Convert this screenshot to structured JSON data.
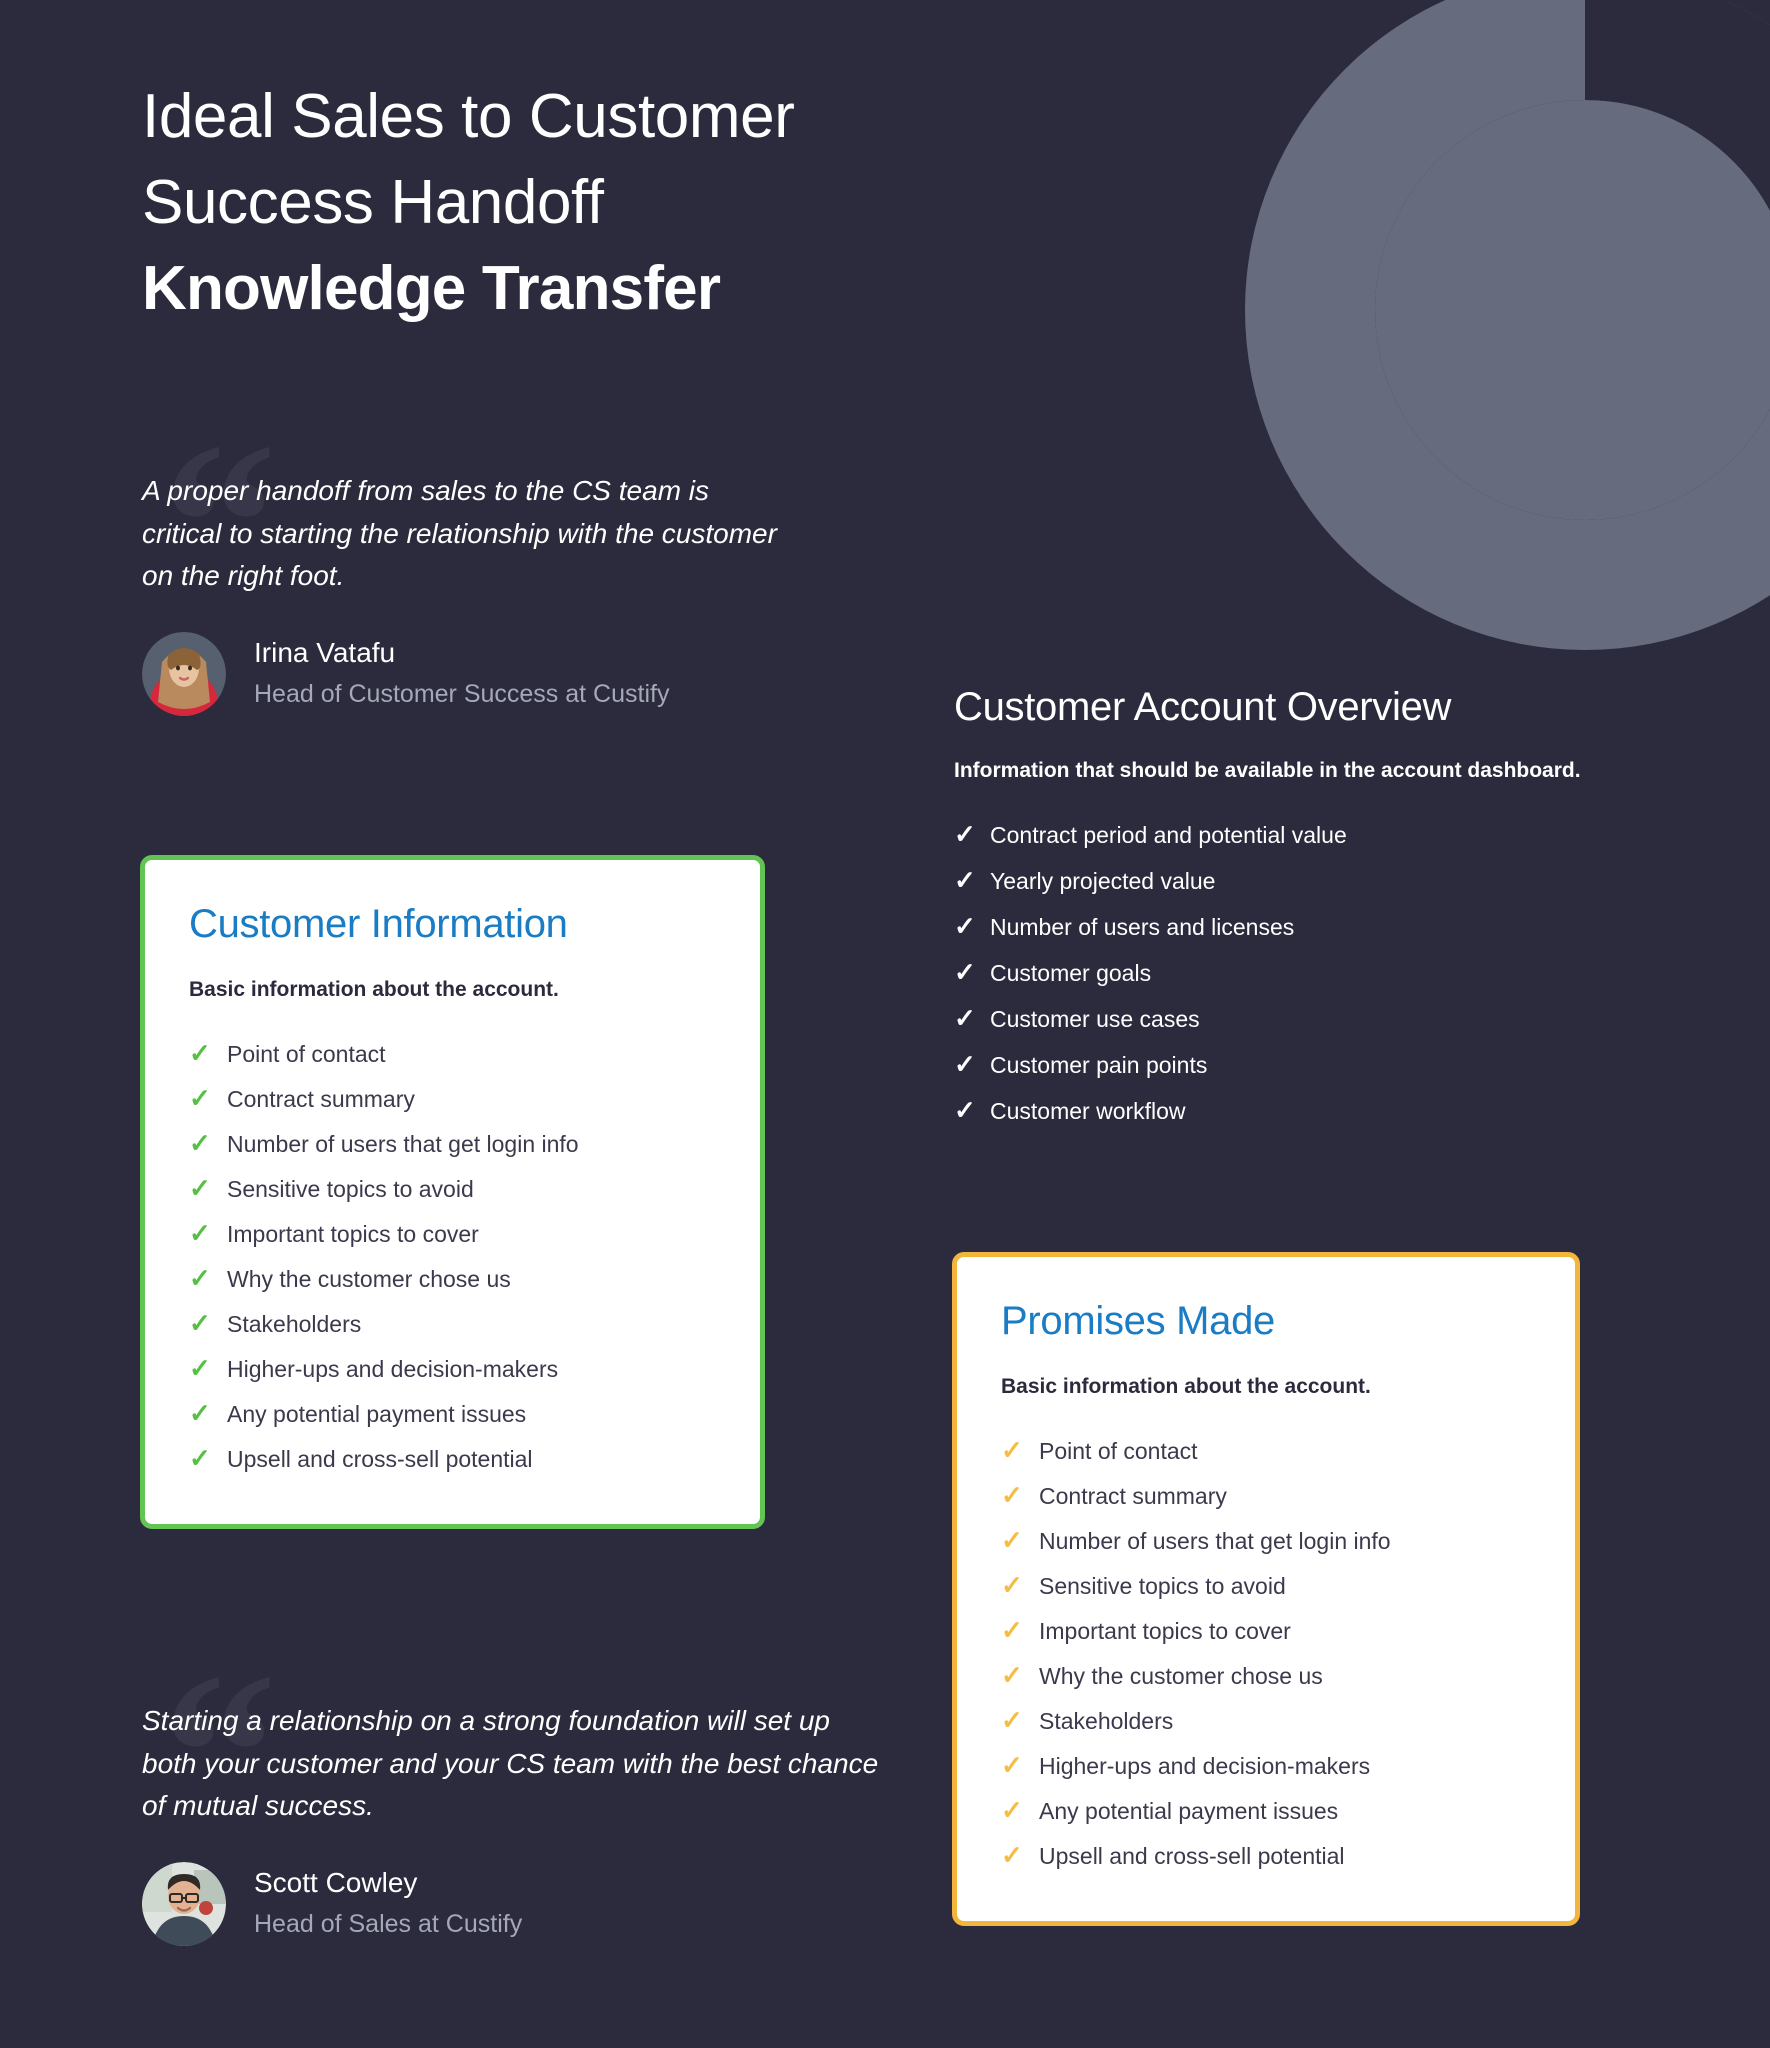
{
  "theme": {
    "background": "#2b2b3d",
    "logo_grey": "#676b7e",
    "heading_blue": "#1a7cc4",
    "green_accent": "#61c453",
    "amber_accent": "#f2b63c",
    "quote_mark_grey": "#373749"
  },
  "header": {
    "line1": "Ideal Sales to Customer",
    "line2": "Success Handoff",
    "line3": "Knowledge Transfer"
  },
  "quote_top": {
    "mark": "“",
    "text": "A proper handoff from sales to the CS team is critical to starting the relationship with the customer on the right foot.",
    "author_name": "Irina Vatafu",
    "author_role": "Head of Customer Success at Custify"
  },
  "quote_bottom": {
    "mark": "“",
    "text": "Starting a relationship on a strong foundation will set up both your customer and your CS team with the best chance of mutual success.",
    "author_name": "Scott Cowley",
    "author_role": "Head of Sales at Custify"
  },
  "customer_information_card": {
    "title": "Customer Information",
    "subtitle": "Basic information about the account.",
    "tick": "✓",
    "items": [
      "Point of contact",
      "Contract summary",
      "Number of users that get login info",
      "Sensitive topics to avoid",
      "Important topics to cover",
      "Why the customer chose us",
      "Stakeholders",
      "Higher-ups and decision-makers",
      "Any potential payment issues",
      "Upsell and cross-sell potential"
    ]
  },
  "account_overview": {
    "title": "Customer Account Overview",
    "subtitle": "Information that should be available in the account dashboard.",
    "tick": "✓",
    "items": [
      "Contract period and potential value",
      "Yearly projected value",
      "Number of users and licenses",
      "Customer goals",
      "Customer use cases",
      "Customer pain points",
      "Customer workflow"
    ]
  },
  "promises_made_card": {
    "title": "Promises Made",
    "subtitle": "Basic information about the account.",
    "tick": "✓",
    "items": [
      "Point of contact",
      "Contract summary",
      "Number of users that get login info",
      "Sensitive topics to avoid",
      "Important topics to cover",
      "Why the customer chose us",
      "Stakeholders",
      "Higher-ups and decision-makers",
      "Any potential payment issues",
      "Upsell and cross-sell potential"
    ]
  }
}
